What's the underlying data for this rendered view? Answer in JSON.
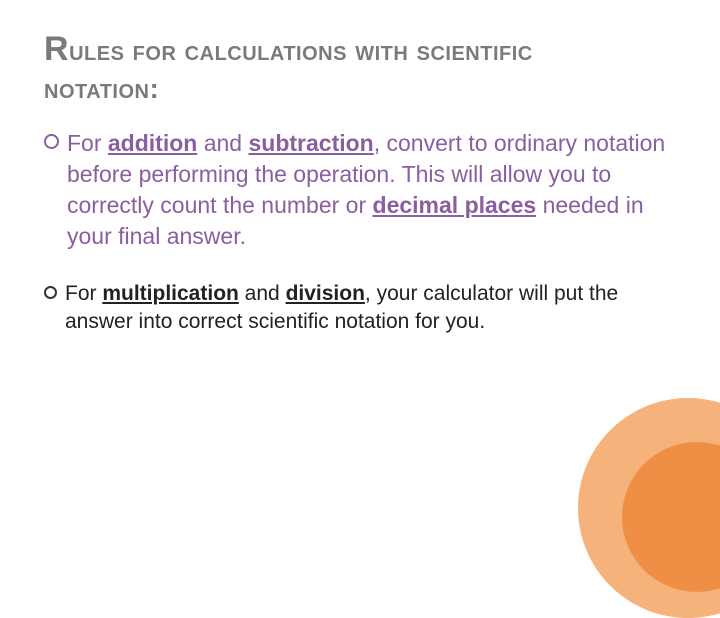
{
  "title": {
    "line1_big": "R",
    "line1_rest": "ules for calculations with scientific",
    "line2": "notation:"
  },
  "bullet1": {
    "pre": "For ",
    "u1": "addition",
    "mid1": " and ",
    "u2": "subtraction",
    "mid2": ", convert to ordinary notation before performing the operation.  This will allow you to correctly count the number or ",
    "u3": "decimal places",
    "post": " needed in your final answer."
  },
  "bullet2": {
    "pre": "For ",
    "u1": "multiplication",
    "mid1": " and ",
    "u2": "division",
    "post": ",  your calculator will put the answer into correct scientific notation for you."
  }
}
